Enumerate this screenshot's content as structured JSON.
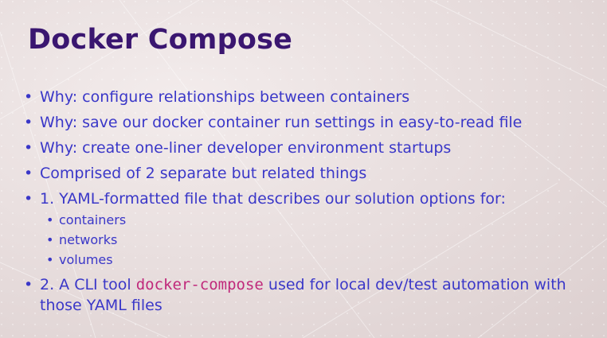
{
  "slide": {
    "title": "Docker Compose",
    "bullet_glyph": "•",
    "bullets": [
      "Why: configure relationships between containers",
      "Why: save our docker container run settings in easy-to-read file",
      "Why: create one-liner developer environment startups",
      "Comprised of 2 separate but related things",
      "1. YAML-formatted file that describes our solution options for:"
    ],
    "sub_bullets": [
      "containers",
      "networks",
      "volumes"
    ],
    "last_bullet": {
      "prefix": "2. A CLI tool ",
      "code": "docker-compose",
      "suffix": " used for local dev/test automation with those YAML files"
    }
  },
  "colors": {
    "title": "#3a1670",
    "bullet_text": "#3a37c8",
    "code_text": "#c0297b",
    "background": "#e7dcdc"
  }
}
